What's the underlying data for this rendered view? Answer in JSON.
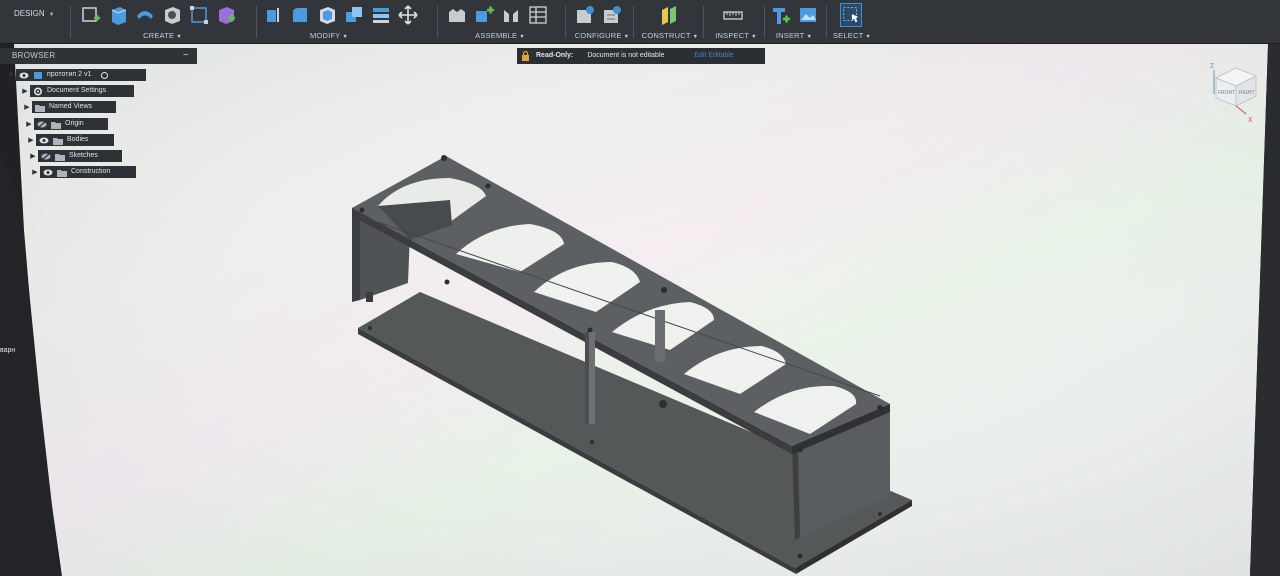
{
  "workspace": {
    "label": "DESIGN"
  },
  "toolbar": {
    "groups": [
      {
        "label": "CREATE"
      },
      {
        "label": "MODIFY"
      },
      {
        "label": "ASSEMBLE"
      },
      {
        "label": "CONFIGURE"
      },
      {
        "label": "CONSTRUCT"
      },
      {
        "label": "INSPECT"
      },
      {
        "label": "INSERT"
      },
      {
        "label": "SELECT"
      }
    ]
  },
  "browser": {
    "title": "BROWSER",
    "root": "прототип 2 v1",
    "items": [
      {
        "label": "Document Settings"
      },
      {
        "label": "Named Views"
      },
      {
        "label": "Origin"
      },
      {
        "label": "Bodies"
      },
      {
        "label": "Sketches"
      },
      {
        "label": "Construction"
      }
    ]
  },
  "banner": {
    "title": "Read-Only:",
    "message": "Document is not editable",
    "link": "Edit Editable"
  },
  "viewcube": {
    "front": "FRONT",
    "right": "RIGHT",
    "z": "Z",
    "x": "X"
  },
  "side_text": "варн",
  "colors": {
    "toolbar": "#32363b",
    "accent": "#3f8fd6",
    "model": "#4a4d50",
    "banner_link": "#4a7fc1"
  }
}
